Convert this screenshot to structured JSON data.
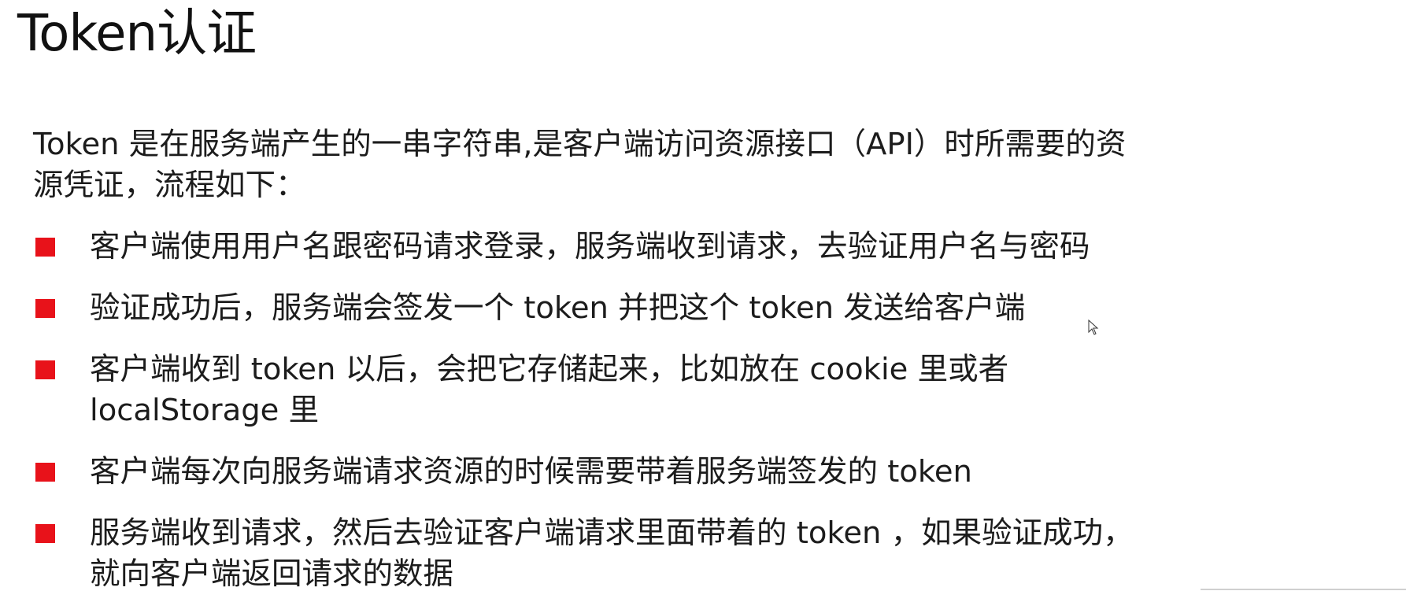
{
  "slide": {
    "title": "Token认证",
    "intro_lines": [
      "Token 是在服务端产生的一串字符串,是客户端访问资源接口（API）时所需要的资",
      "源凭证，流程如下："
    ],
    "bullets": [
      {
        "lines": [
          "客户端使用用户名跟密码请求登录，服务端收到请求，去验证用户名与密码"
        ]
      },
      {
        "lines": [
          "验证成功后，服务端会签发一个 token 并把这个 token 发送给客户端"
        ]
      },
      {
        "lines": [
          "客户端收到 token 以后，会把它存储起来，比如放在 cookie 里或者",
          "localStorage 里"
        ]
      },
      {
        "lines": [
          "客户端每次向服务端请求资源的时候需要带着服务端签发的 token"
        ]
      },
      {
        "lines": [
          "服务端收到请求，然后去验证客户端请求里面带着的 token ，如果验证成功，",
          "就向客户端返回请求的数据"
        ]
      }
    ],
    "bullet_icon": "square-bullet-icon",
    "cursor_icon": "mouse-pointer-icon",
    "colors": {
      "bullet": "#e8121a",
      "text": "#1c1c1c",
      "background": "#ffffff"
    }
  }
}
